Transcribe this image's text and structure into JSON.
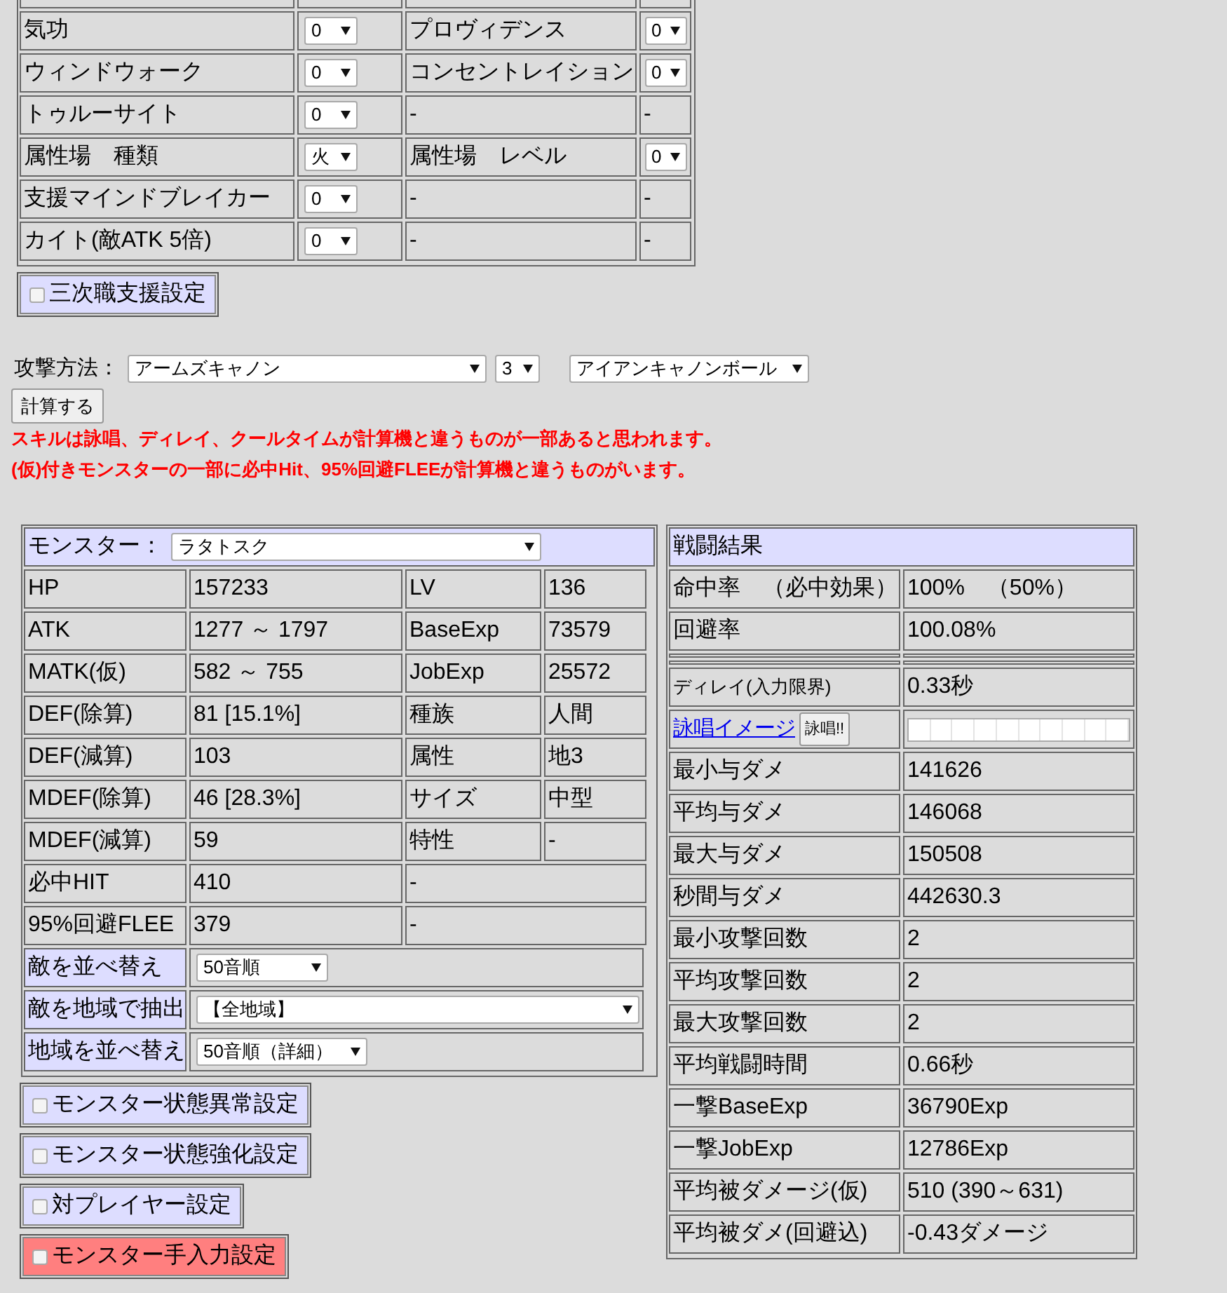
{
  "support_table": {
    "rows": [
      {
        "cells": [
          {
            "kind": "text",
            "text": ""
          },
          {
            "kind": "text",
            "text": ""
          },
          {
            "kind": "text",
            "text": ""
          },
          {
            "kind": "text",
            "text": ""
          }
        ]
      },
      {
        "cells": [
          {
            "kind": "text",
            "text": "気功"
          },
          {
            "kind": "select",
            "text": "0"
          },
          {
            "kind": "text",
            "text": "プロヴィデンス"
          },
          {
            "kind": "select",
            "text": "0"
          }
        ]
      },
      {
        "cells": [
          {
            "kind": "text",
            "text": "ウィンドウォーク"
          },
          {
            "kind": "select",
            "text": "0"
          },
          {
            "kind": "text",
            "text": "コンセントレイション"
          },
          {
            "kind": "select",
            "text": "0"
          }
        ]
      },
      {
        "cells": [
          {
            "kind": "text",
            "text": "トゥルーサイト"
          },
          {
            "kind": "select",
            "text": "0"
          },
          {
            "kind": "text",
            "text": "-"
          },
          {
            "kind": "text",
            "text": "-"
          }
        ]
      },
      {
        "cells": [
          {
            "kind": "text",
            "text": "属性場　種類"
          },
          {
            "kind": "select",
            "text": "火"
          },
          {
            "kind": "text",
            "text": "属性場　レベル"
          },
          {
            "kind": "select",
            "text": "0"
          }
        ]
      },
      {
        "cells": [
          {
            "kind": "text",
            "text": "支援マインドブレイカー"
          },
          {
            "kind": "select",
            "text": "0"
          },
          {
            "kind": "text",
            "text": "-"
          },
          {
            "kind": "text",
            "text": "-"
          }
        ]
      },
      {
        "cells": [
          {
            "kind": "text",
            "text": "カイト(敵ATK 5倍)"
          },
          {
            "kind": "select",
            "text": "0"
          },
          {
            "kind": "text",
            "text": "-"
          },
          {
            "kind": "text",
            "text": "-"
          }
        ]
      }
    ]
  },
  "third_job_panel": {
    "label": "三次職支援設定",
    "checked": false,
    "highlighted": false
  },
  "attack": {
    "label": "攻撃方法：",
    "skill": "アームズキャノン",
    "skill_lv": "3",
    "ammo": "アイアンキャノンボール",
    "button": "計算する",
    "notes": [
      "スキルは詠唱、ディレイ、クールタイムが計算機と違うものが一部あると思われます。",
      "(仮)付きモンスターの一部に必中Hit、95%回避FLEEが計算機と違うものがいます。"
    ]
  },
  "monster": {
    "label": "モンスター：",
    "selected": "ラタトスク",
    "stats": [
      [
        "HP",
        "157233",
        "LV",
        "136"
      ],
      [
        "ATK",
        "1277 ～ 1797",
        "BaseExp",
        "73579"
      ],
      [
        "MATK(仮)",
        "582 ～ 755",
        "JobExp",
        "25572"
      ],
      [
        "DEF(除算)",
        "81 [15.1%]",
        "種族",
        "人間"
      ],
      [
        "DEF(減算)",
        "103",
        "属性",
        "地3"
      ],
      [
        "MDEF(除算)",
        "46 [28.3%]",
        "サイズ",
        "中型"
      ],
      [
        "MDEF(減算)",
        "59",
        "特性",
        "-"
      ],
      [
        "必中HIT",
        "410",
        "-"
      ],
      [
        "95%回避FLEE",
        "379",
        "-"
      ]
    ],
    "filters": [
      {
        "label": "敵を並べ替え",
        "value": "50音順"
      },
      {
        "label": "敵を地域で抽出",
        "value": "【全地域】"
      },
      {
        "label": "地域を並べ替え",
        "value": "50音順（詳細）"
      }
    ]
  },
  "panels": [
    {
      "label": "モンスター状態異常設定",
      "checked": false,
      "highlighted": false
    },
    {
      "label": "モンスター状態強化設定",
      "checked": false,
      "highlighted": false
    },
    {
      "label": "対プレイヤー設定",
      "checked": false,
      "highlighted": false
    },
    {
      "label": "モンスター手入力設定",
      "checked": false,
      "highlighted": true
    }
  ],
  "battle": {
    "title": "戦闘結果",
    "rows": [
      {
        "kind": "pair",
        "label": "命中率　（必中効果）",
        "value": "100%　（50%）"
      },
      {
        "kind": "pair",
        "label": "回避率",
        "value": "100.08%"
      },
      {
        "kind": "spacer"
      },
      {
        "kind": "spacer"
      },
      {
        "kind": "small",
        "label": "ディレイ(入力限界)",
        "value": "0.33秒"
      },
      {
        "kind": "chant",
        "link": "詠唱イメージ",
        "button": "詠唱!!"
      },
      {
        "kind": "pair",
        "label": "最小与ダメ",
        "value": "141626"
      },
      {
        "kind": "pair",
        "label": "平均与ダメ",
        "value": "146068"
      },
      {
        "kind": "pair",
        "label": "最大与ダメ",
        "value": "150508"
      },
      {
        "kind": "pair",
        "label": "秒間与ダメ",
        "value": "442630.3"
      },
      {
        "kind": "pair",
        "label": "最小攻撃回数",
        "value": "2"
      },
      {
        "kind": "pair",
        "label": "平均攻撃回数",
        "value": "2"
      },
      {
        "kind": "pair",
        "label": "最大攻撃回数",
        "value": "2"
      },
      {
        "kind": "pair",
        "label": "平均戦闘時間",
        "value": "0.66秒"
      },
      {
        "kind": "pair",
        "label": "一撃BaseExp",
        "value": "36790Exp"
      },
      {
        "kind": "pair",
        "label": "一撃JobExp",
        "value": "12786Exp"
      },
      {
        "kind": "pair",
        "label": "平均被ダメージ(仮)",
        "value": "510 (390～631)"
      },
      {
        "kind": "pair",
        "label": "平均被ダメ(回避込)",
        "value": "-0.43ダメージ"
      }
    ]
  }
}
